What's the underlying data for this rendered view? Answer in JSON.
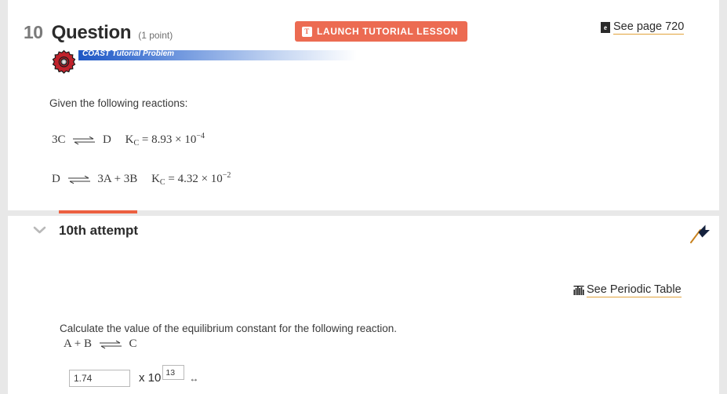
{
  "question": {
    "number": "10",
    "title": "Question",
    "points": "(1 point)",
    "launch_button": {
      "label": "LAUNCH TUTORIAL LESSON",
      "icon_letter": "T",
      "color": "#ec6b52"
    },
    "see_page": {
      "label": "See page 720",
      "icon_letter": "e",
      "underline_color": "#e2a33c"
    },
    "coast_banner": {
      "label": "COAST Tutorial Problem",
      "gear_color": "#c0222b",
      "bar_start_color": "#1f57c4"
    },
    "given_text": "Given the following reactions:",
    "reactions": [
      {
        "left": "3C",
        "right": "D",
        "k_label": "K",
        "k_sub": "C",
        "equals": "=",
        "coefficient": "8.93",
        "times": "×",
        "base": "10",
        "exponent": "−4"
      },
      {
        "left": "D",
        "right": "3A + 3B",
        "k_label": "K",
        "k_sub": "C",
        "equals": "=",
        "coefficient": "4.32",
        "times": "×",
        "base": "10",
        "exponent": "−2"
      }
    ]
  },
  "attempt": {
    "title": "10th attempt",
    "tab_color": "#ec6041",
    "flag_icon": "flag-icon",
    "chevron_icon": "chevron-down-icon",
    "periodic_table": {
      "label": "See Periodic Table",
      "underline_color": "#e2a33c"
    },
    "prompt": "Calculate the value of the equilibrium constant for the following reaction.",
    "reaction": {
      "left": "A + B",
      "right": "C"
    },
    "answer": {
      "mantissa_value": "1.74",
      "mantissa_placeholder": "",
      "times_label": "x 10",
      "exponent_value": "13",
      "exponent_placeholder": "",
      "resize_handle": "↔"
    }
  }
}
